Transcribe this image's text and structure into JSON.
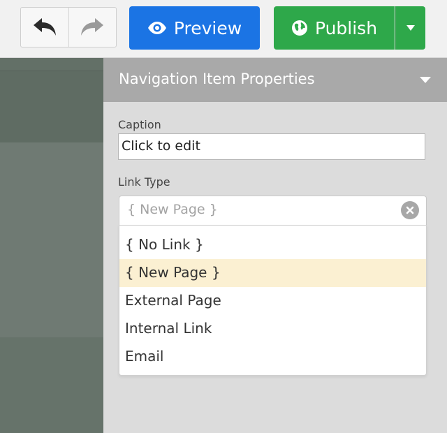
{
  "toolbar": {
    "undo_icon": "undo-arrow-icon",
    "redo_icon": "redo-arrow-icon",
    "preview_label": "Preview",
    "preview_icon": "eye-icon",
    "publish_label": "Publish",
    "publish_icon": "globe-icon",
    "publish_menu_icon": "caret-down-icon",
    "colors": {
      "preview": "#1b74e4",
      "publish": "#2ea84a"
    }
  },
  "panel": {
    "title": "Navigation Item Properties",
    "caption_label": "Caption",
    "caption_value": "Click to edit",
    "link_type_label": "Link Type",
    "link_type_value": "{ New Page }",
    "options": [
      {
        "label": "{ No Link }",
        "highlighted": false
      },
      {
        "label": "{ New Page }",
        "highlighted": true
      },
      {
        "label": "External Page",
        "highlighted": false
      },
      {
        "label": "Internal Link",
        "highlighted": false
      },
      {
        "label": "Email",
        "highlighted": false
      }
    ]
  }
}
